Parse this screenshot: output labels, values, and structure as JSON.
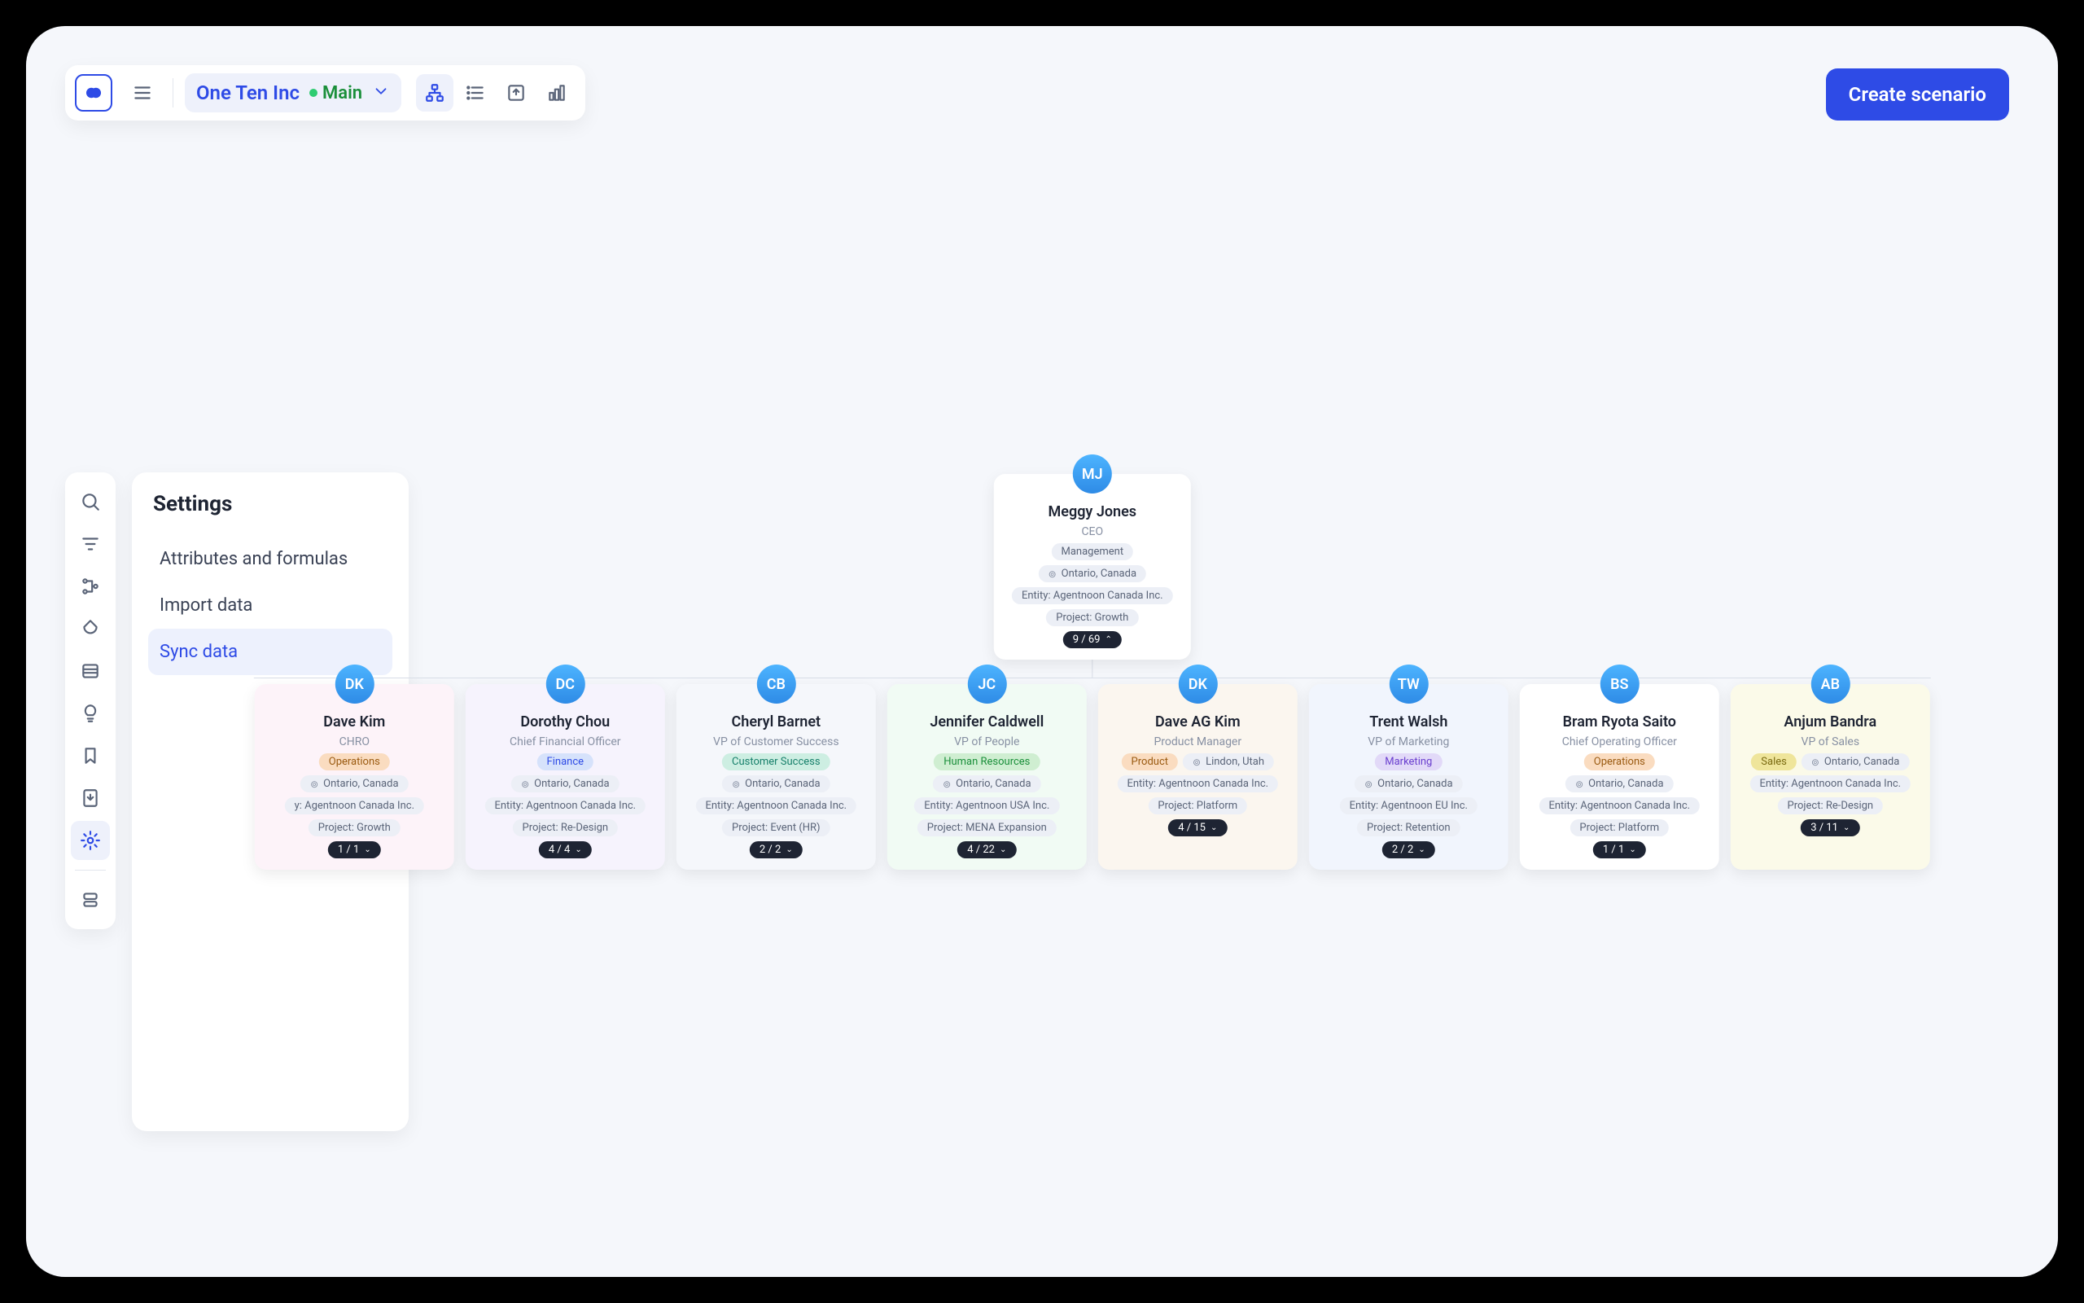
{
  "toolbar": {
    "org_name": "One Ten Inc",
    "branch_label": "Main"
  },
  "actions": {
    "create_scenario": "Create scenario"
  },
  "settings": {
    "title": "Settings",
    "items": [
      {
        "label": "Attributes and formulas",
        "selected": false
      },
      {
        "label": "Import data",
        "selected": false
      },
      {
        "label": "Sync data",
        "selected": true
      }
    ]
  },
  "org": {
    "root": {
      "initials": "MJ",
      "name": "Meggy Jones",
      "title": "CEO",
      "dept": "Management",
      "location": "Ontario, Canada",
      "entity": "Entity:  Agentnoon Canada Inc.",
      "project": "Project:  Growth",
      "count": "9 / 69",
      "dir": "up"
    },
    "children": [
      {
        "color": "c-pink",
        "initials": "DK",
        "name": "Dave Kim",
        "title": "CHRO",
        "dept": "Operations",
        "dept_cls": "dept-orange",
        "location": "Ontario, Canada",
        "entity": "y:  Agentnoon Canada Inc.",
        "project": "Project:  Growth",
        "count": "1 / 1",
        "dir": "down"
      },
      {
        "color": "c-purple",
        "initials": "DC",
        "name": "Dorothy Chou",
        "title": "Chief Financial Officer",
        "dept": "Finance",
        "dept_cls": "dept-blue",
        "location": "Ontario, Canada",
        "entity": "Entity:  Agentnoon Canada Inc.",
        "project": "Project:  Re-Design",
        "count": "4 / 4",
        "dir": "down"
      },
      {
        "color": "c-gray",
        "initials": "CB",
        "name": "Cheryl Barnet",
        "title": "VP of Customer Success",
        "dept": "Customer Success",
        "dept_cls": "dept-teal",
        "location": "Ontario, Canada",
        "entity": "Entity:  Agentnoon Canada Inc.",
        "project": "Project:  Event (HR)",
        "count": "2 / 2",
        "dir": "down"
      },
      {
        "color": "c-green",
        "initials": "JC",
        "name": "Jennifer Caldwell",
        "title": "VP of People",
        "dept": "Human Resources",
        "dept_cls": "dept-green",
        "location": "Ontario, Canada",
        "entity": "Entity:  Agentnoon USA Inc.",
        "project": "Project:  MENA Expansion",
        "count": "4 / 22",
        "dir": "down"
      },
      {
        "color": "c-orange",
        "initials": "DK",
        "name": "Dave AG Kim",
        "title": "Product Manager",
        "dept": "Product",
        "dept_cls": "dept-orange",
        "location": "Lindon, Utah",
        "entity": "Entity:  Agentnoon Canada Inc.",
        "project": "Project:  Platform",
        "count": "4 / 15",
        "dir": "down",
        "split_row": true
      },
      {
        "color": "c-blue",
        "initials": "TW",
        "name": "Trent Walsh",
        "title": "VP of Marketing",
        "dept": "Marketing",
        "dept_cls": "dept-purple",
        "location": "Ontario, Canada",
        "entity": "Entity:  Agentnoon EU Inc.",
        "project": "Project:  Retention",
        "count": "2 / 2",
        "dir": "down"
      },
      {
        "color": "c-plain",
        "initials": "BS",
        "name": "Bram Ryota Saito",
        "title": "Chief Operating Officer",
        "dept": "Operations",
        "dept_cls": "dept-orange",
        "location": "Ontario, Canada",
        "entity": "Entity:  Agentnoon Canada Inc.",
        "project": "Project:  Platform",
        "count": "1 / 1",
        "dir": "down"
      },
      {
        "color": "c-yellow",
        "initials": "AB",
        "name": "Anjum Bandra",
        "title": "VP of Sales",
        "dept": "Sales",
        "dept_cls": "dept-yellow",
        "location": "Ontario, Canada",
        "entity": "Entity:  Agentnoon Canada Inc.",
        "project": "Project:  Re-Design",
        "count": "3 / 11",
        "dir": "down",
        "split_row": true
      }
    ]
  }
}
